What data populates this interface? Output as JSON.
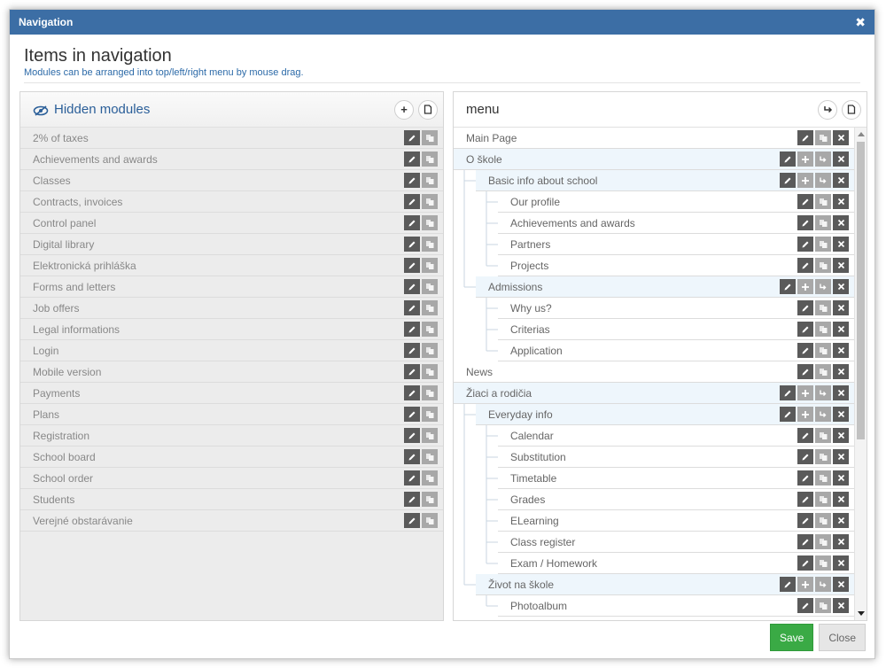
{
  "dialog": {
    "title": "Navigation",
    "close_glyph": "✖",
    "heading": "Items in navigation",
    "subheading": "Modules can be arranged into top/left/right menu by mouse drag."
  },
  "left": {
    "title": "Hidden modules",
    "add_glyph": "+",
    "copy_glyph": "⧉",
    "items": [
      "2% of taxes",
      "Achievements and awards",
      "Classes",
      "Contracts, invoices",
      "Control panel",
      "Digital library",
      "Elektronická prihláška",
      "Forms and letters",
      "Job offers",
      "Legal informations",
      "Login",
      "Mobile version",
      "Payments",
      "Plans",
      "Registration",
      "School board",
      "School order",
      "Students",
      "Verejné obstarávanie"
    ]
  },
  "right": {
    "title": "menu",
    "link_glyph": "↪",
    "copy_glyph": "⧉",
    "items": [
      {
        "label": "Main Page",
        "level": 0,
        "group": false
      },
      {
        "label": "O škole",
        "level": 0,
        "group": true
      },
      {
        "label": "Basic info about school",
        "level": 1,
        "group": true
      },
      {
        "label": "Our profile",
        "level": 2,
        "group": false
      },
      {
        "label": "Achievements and awards",
        "level": 2,
        "group": false
      },
      {
        "label": "Partners",
        "level": 2,
        "group": false
      },
      {
        "label": "Projects",
        "level": 2,
        "group": false
      },
      {
        "label": "Admissions",
        "level": 1,
        "group": true
      },
      {
        "label": "Why us?",
        "level": 2,
        "group": false
      },
      {
        "label": "Criterias",
        "level": 2,
        "group": false
      },
      {
        "label": "Application",
        "level": 2,
        "group": false
      },
      {
        "label": "News",
        "level": 0,
        "group": false
      },
      {
        "label": "Žiaci a rodičia",
        "level": 0,
        "group": true
      },
      {
        "label": "Everyday info",
        "level": 1,
        "group": true
      },
      {
        "label": "Calendar",
        "level": 2,
        "group": false
      },
      {
        "label": "Substitution",
        "level": 2,
        "group": false
      },
      {
        "label": "Timetable",
        "level": 2,
        "group": false
      },
      {
        "label": "Grades",
        "level": 2,
        "group": false
      },
      {
        "label": "ELearning",
        "level": 2,
        "group": false
      },
      {
        "label": "Class register",
        "level": 2,
        "group": false
      },
      {
        "label": "Exam / Homework",
        "level": 2,
        "group": false
      },
      {
        "label": "Život na škole",
        "level": 1,
        "group": true
      },
      {
        "label": "Photoalbum",
        "level": 2,
        "group": false
      }
    ]
  },
  "footer": {
    "save_label": "Save",
    "close_label": "Close"
  },
  "colors": {
    "titlebar": "#3c6ea5",
    "save": "#3aaa45",
    "group_row": "#eef6fc"
  }
}
